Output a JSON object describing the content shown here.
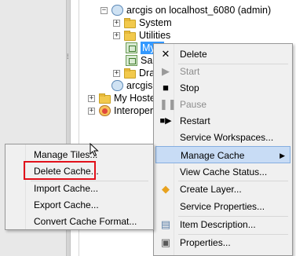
{
  "tree": {
    "root": "arcgis on localhost_6080 (admin)",
    "children": [
      "System",
      "Utilities",
      "My...",
      "San",
      "Dra"
    ],
    "sibling_server": "arcgis",
    "hosted": "My Hoste",
    "interop": "Interopera"
  },
  "context_menu": {
    "items": [
      {
        "label": "Delete",
        "icon": "close-icon",
        "enabled": true
      },
      {
        "label": "Start",
        "icon": "play-icon",
        "enabled": false
      },
      {
        "label": "Stop",
        "icon": "stop-icon",
        "enabled": true
      },
      {
        "label": "Pause",
        "icon": "pause-icon",
        "enabled": false
      },
      {
        "label": "Restart",
        "icon": "restart-icon",
        "enabled": true
      },
      {
        "label": "Service Workspaces...",
        "icon": "",
        "enabled": true
      },
      {
        "label": "Manage Cache",
        "icon": "",
        "enabled": true,
        "submenu": true,
        "highlighted": true
      },
      {
        "label": "View Cache Status...",
        "icon": "",
        "enabled": true
      },
      {
        "label": "Create Layer...",
        "icon": "diamond-icon",
        "enabled": true
      },
      {
        "label": "Service Properties...",
        "icon": "",
        "enabled": true
      },
      {
        "label": "Item Description...",
        "icon": "document-icon",
        "enabled": true
      },
      {
        "label": "Properties...",
        "icon": "properties-icon",
        "enabled": true
      }
    ]
  },
  "submenu": {
    "items": [
      {
        "label": "Manage Tiles..."
      },
      {
        "label": "Delete Cache..."
      },
      {
        "label": "Import Cache..."
      },
      {
        "label": "Export Cache..."
      },
      {
        "label": "Convert Cache Format..."
      }
    ]
  },
  "colors": {
    "highlight_border": "#e1101a",
    "selection": "#3399ff",
    "menu_hover": "#c8dcf5"
  }
}
